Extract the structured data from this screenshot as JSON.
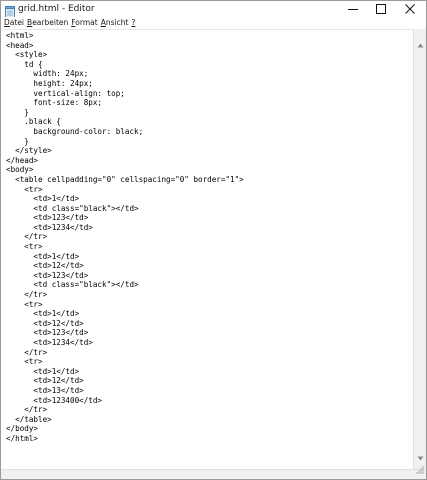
{
  "window": {
    "title": "grid.html - Editor",
    "icon": "notepad-icon",
    "controls": {
      "minimize": "minimize-icon",
      "maximize": "maximize-icon",
      "close": "close-icon"
    }
  },
  "menu": {
    "items": [
      {
        "label": "Datei",
        "accel": "D",
        "rest": "atei"
      },
      {
        "label": "Bearbeiten",
        "accel": "B",
        "rest": "earbeiten"
      },
      {
        "label": "Format",
        "accel": "F",
        "rest": "ormat"
      },
      {
        "label": "Ansicht",
        "accel": "A",
        "rest": "nsicht"
      },
      {
        "label": "?",
        "accel": "?",
        "rest": ""
      }
    ]
  },
  "editor": {
    "lines": [
      "<html>",
      "<head>",
      "  <style>",
      "    td {",
      "      width: 24px;",
      "      height: 24px;",
      "      vertical-align: top;",
      "      font-size: 8px;",
      "    }",
      "    .black {",
      "      background-color: black;",
      "    }",
      "  </style>",
      "</head>",
      "<body>",
      "  <table cellpadding=\"0\" cellspacing=\"0\" border=\"1\">",
      "    <tr>",
      "      <td>1</td>",
      "      <td class=\"black\"></td>",
      "      <td>123</td>",
      "      <td>1234</td>",
      "    </tr>",
      "    <tr>",
      "      <td>1</td>",
      "      <td>12</td>",
      "      <td>123</td>",
      "      <td class=\"black\"></td>",
      "    </tr>",
      "    <tr>",
      "      <td>1</td>",
      "      <td>12</td>",
      "      <td>123</td>",
      "      <td>1234</td>",
      "    </tr>",
      "    <tr>",
      "      <td>1</td>",
      "      <td>12</td>",
      "      <td>13</td>",
      "      <td>123400</td>",
      "    </tr>",
      "  </table>",
      "</body>",
      "</html>"
    ]
  }
}
